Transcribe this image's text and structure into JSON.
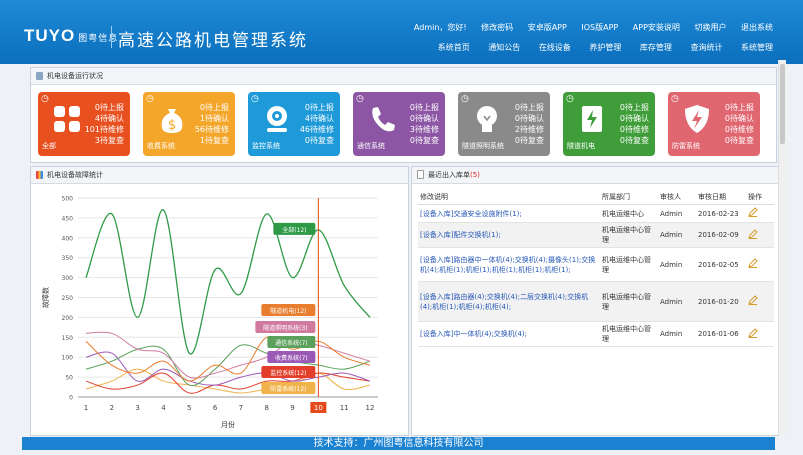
{
  "header": {
    "logo_text": "TUYO",
    "logo_company": "图粤信息",
    "system_title": "高速公路机电管理系统",
    "top_links": [
      "Admin，您好!",
      "修改密码",
      "安卓版APP",
      "IOS版APP",
      "APP安装说明",
      "切换用户",
      "退出系统"
    ],
    "nav": [
      "系统首页",
      "通知公告",
      "在线设备",
      "养护管理",
      "库存管理",
      "查询统计",
      "系统管理"
    ]
  },
  "status_panel": {
    "title": "机电设备运行状况"
  },
  "tiles": [
    {
      "name": "全部",
      "color": "#e8501f",
      "icon": "grid-icon",
      "stats": [
        "0待上报",
        "4待确认",
        "101待维修",
        "3待复查"
      ]
    },
    {
      "name": "收费系统",
      "color": "#f4a62a",
      "icon": "money-bag-icon",
      "stats": [
        "0待上报",
        "1待确认",
        "56待维修",
        "1待复查"
      ]
    },
    {
      "name": "监控系统",
      "color": "#1e9ad8",
      "icon": "camera-icon",
      "stats": [
        "0待上报",
        "4待确认",
        "46待维修",
        "0待复查"
      ]
    },
    {
      "name": "通信系统",
      "color": "#8c56a4",
      "icon": "phone-icon",
      "stats": [
        "0待上报",
        "0待确认",
        "3待维修",
        "0待复查"
      ]
    },
    {
      "name": "隧道照明系统",
      "color": "#8a8a8a",
      "icon": "bulb-icon",
      "stats": [
        "0待上报",
        "0待确认",
        "2待维修",
        "0待复查"
      ]
    },
    {
      "name": "隧道机电",
      "color": "#3f9e3a",
      "icon": "power-icon",
      "stats": [
        "0待上报",
        "0待确认",
        "0待维修",
        "0待复查"
      ]
    },
    {
      "name": "防雷系统",
      "color": "#e06670",
      "icon": "lightning-shield-icon",
      "stats": [
        "0待上报",
        "0待确认",
        "0待维修",
        "0待复查"
      ]
    }
  ],
  "chart_panel": {
    "title": "机电设备故障统计"
  },
  "log_panel": {
    "title": "最近出入库单",
    "count": "(5)",
    "columns": [
      "修改说明",
      "所属部门",
      "审核人",
      "审核日期",
      "操作"
    ],
    "rows": [
      {
        "desc": "[设备入库]交通安全设施附件(1);",
        "dept": "机电运维中心",
        "user": "Admin",
        "date": "2016-02-23"
      },
      {
        "desc": "[设备入库]配件交换机(1);",
        "dept": "机电运维中心管理",
        "user": "Admin",
        "date": "2016-02-09"
      },
      {
        "desc": "[设备入库]路由器中一体机(4);交换机(4);摄像头(1);交换机(4);机柜(1);机柜(1);机柜(1);机柜(1);机柜(1);",
        "dept": "机电运维中心管理",
        "user": "Admin",
        "date": "2016-02-05"
      },
      {
        "desc": "[设备入库]路由器(4);交换机(4);二层交换机(4);交换机(4);机柜(1);机柜(4);机柜(4);",
        "dept": "机电运维中心管理",
        "user": "Admin",
        "date": "2016-01-20"
      },
      {
        "desc": "[设备入库]中一体机(4);交换机(4);",
        "dept": "机电运维中心管理",
        "user": "Admin",
        "date": "2016-01-06"
      }
    ]
  },
  "footer": {
    "text": "技术支持：广州图粤信息科技有限公司"
  },
  "chart_data": {
    "type": "line",
    "title": "",
    "xlabel": "月份",
    "ylabel": "故障数",
    "x": [
      1,
      2,
      3,
      4,
      5,
      6,
      7,
      8,
      9,
      10,
      11,
      12
    ],
    "ylim": [
      0,
      500
    ],
    "yticks": [
      0,
      50,
      100,
      150,
      200,
      250,
      300,
      350,
      400,
      450,
      500
    ],
    "highlight_x": 10,
    "series": [
      {
        "name": "全部",
        "color": "#2e9a46",
        "values": [
          300,
          460,
          200,
          470,
          110,
          320,
          260,
          460,
          300,
          420,
          280,
          200
        ]
      },
      {
        "name": "收费系统",
        "color": "#e97d2e",
        "values": [
          140,
          80,
          60,
          90,
          40,
          80,
          60,
          150,
          120,
          140,
          100,
          80
        ]
      },
      {
        "name": "隧道机电",
        "color": "#d17aa0",
        "values": [
          160,
          160,
          120,
          110,
          50,
          60,
          80,
          100,
          140,
          130,
          110,
          90
        ]
      },
      {
        "name": "监控系统",
        "color": "#5aa05a",
        "values": [
          70,
          90,
          120,
          120,
          30,
          70,
          130,
          110,
          90,
          80,
          70,
          90
        ]
      },
      {
        "name": "通信系统",
        "color": "#9b59b6",
        "values": [
          100,
          110,
          40,
          70,
          40,
          30,
          50,
          60,
          40,
          50,
          60,
          40
        ]
      },
      {
        "name": "防雷系统",
        "color": "#e23e2a",
        "values": [
          40,
          20,
          30,
          60,
          10,
          30,
          20,
          40,
          40,
          60,
          50,
          40
        ]
      },
      {
        "name": "隧道照明系统",
        "color": "#f0b24a",
        "values": [
          20,
          40,
          70,
          40,
          30,
          20,
          10,
          20,
          30,
          60,
          20,
          30
        ]
      }
    ],
    "labels": [
      {
        "text": "全部(12)",
        "series": 0
      },
      {
        "text": "隧道机电(12)",
        "series": 1
      },
      {
        "text": "隧道照明系统(3)",
        "series": 2
      },
      {
        "text": "通信系统(7)",
        "series": 3
      },
      {
        "text": "收费系统(7)",
        "series": 4
      },
      {
        "text": "监控系统(12)",
        "series": 5
      },
      {
        "text": "防雷系统(12)",
        "series": 6
      }
    ]
  }
}
